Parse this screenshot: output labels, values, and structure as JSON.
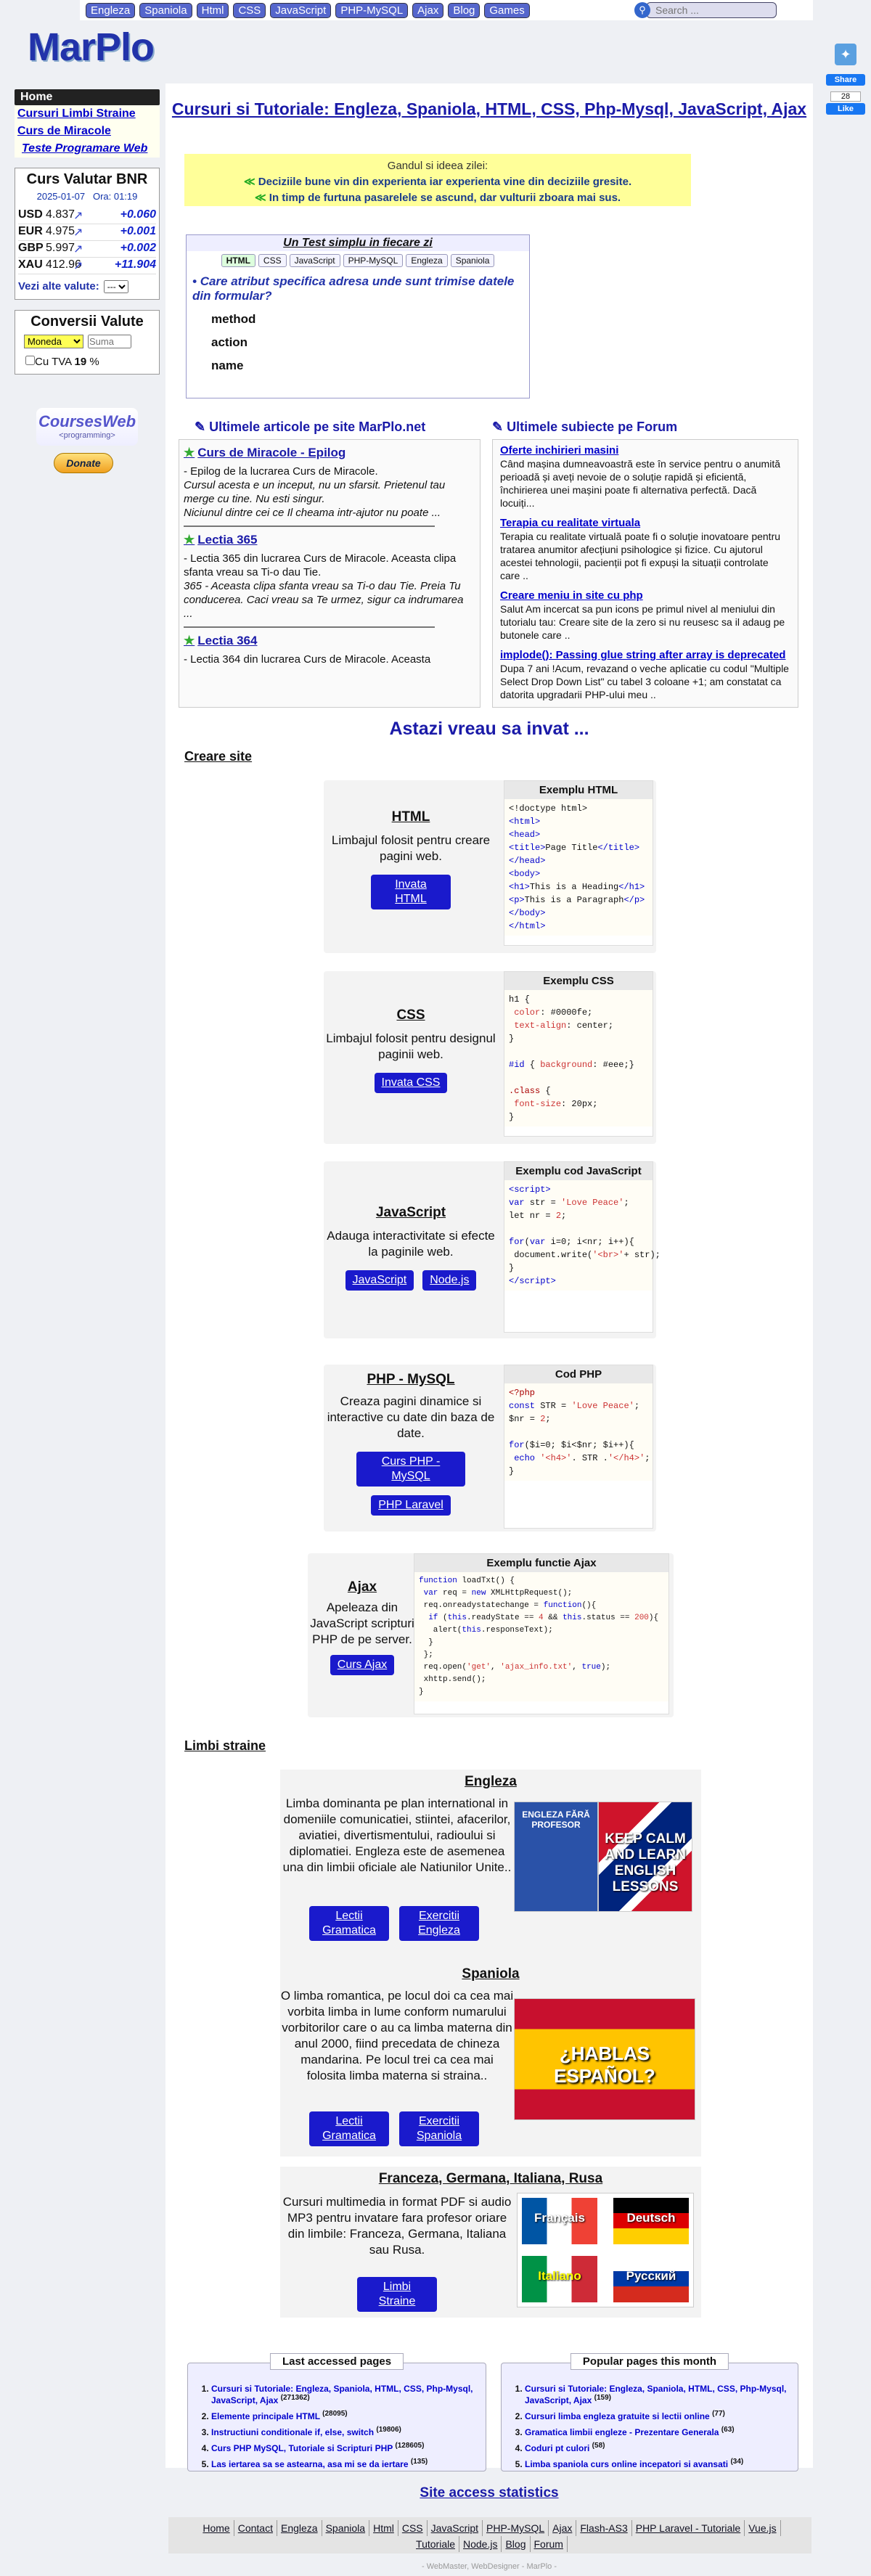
{
  "topnav": {
    "items": [
      "Engleza",
      "Spaniola",
      "Html",
      "CSS",
      "JavaScript",
      "PHP-MySQL",
      "Ajax",
      "Blog",
      "Games"
    ],
    "search_placeholder": "Search ..."
  },
  "logo": "MarPlo",
  "social": {
    "share": "Share",
    "count1": "28",
    "like": "Like"
  },
  "sidebar": {
    "home": "Home",
    "links": [
      "Cursuri Limbi Straine",
      "Curs de Miracole",
      "Teste Programare Web"
    ]
  },
  "currency": {
    "title": "Curs Valutar BNR",
    "date": "2025-01-07",
    "time": "Ora: 01:19",
    "rows": [
      {
        "code": "USD",
        "value": "4.837",
        "delta": "+0.060"
      },
      {
        "code": "EUR",
        "value": "4.975",
        "delta": "+0.001"
      },
      {
        "code": "GBP",
        "value": "5.997",
        "delta": "+0.002"
      },
      {
        "code": "XAU",
        "value": "412.96",
        "delta": "+11.904"
      }
    ],
    "vezi": "Vezi alte valute:",
    "select": "---"
  },
  "conversii": {
    "title": "Conversii Valute",
    "moneda": "Moneda",
    "suma": "Suma",
    "tva_label": "Cu TVA",
    "tva_value": "19",
    "tva_pct": "%"
  },
  "coursesweb": {
    "t1": "CoursesWeb",
    "t2": "<programming>"
  },
  "donate": "Donate",
  "page_title": "Cursuri si Tutoriale: Engleza, Spaniola, HTML, CSS, Php-Mysql, JavaScript, Ajax",
  "gandul": {
    "title": "Gandul si ideea zilei:",
    "lines": [
      "Deciziile bune vin din experienta iar experienta vine din deciziile gresite.",
      "In timp de furtuna pasarelele se ascund, dar vulturii zboara mai sus."
    ]
  },
  "test": {
    "title": "Un Test simplu in fiecare zi",
    "tags": [
      "HTML",
      "CSS",
      "JavaScript",
      "PHP-MySQL",
      "Engleza",
      "Spaniola"
    ],
    "question": "Care atribut specifica adresa unde sunt trimise datele din formular?",
    "options": [
      "method",
      "action",
      "name"
    ]
  },
  "articles": {
    "title": "Ultimele articole pe site MarPlo.net",
    "items": [
      {
        "title": "Curs de Miracole - Epilog",
        "text": "- Epilog de la lucrarea Curs de Miracole.",
        "italic": "Cursul acesta e un inceput, nu un sfarsit. Prietenul tau merge cu tine. Nu esti singur.",
        "tail": "Niciunul dintre cei ce Il cheama intr-ajutor nu poate ..."
      },
      {
        "title": "Lectia 365",
        "text": "- Lectia 365 din lucrarea Curs de Miracole. Aceasta clipa sfanta vreau sa Ti-o dau Tie.",
        "italic": "365 - Aceasta clipa sfanta vreau sa Ti-o dau Tie. Preia Tu conducerea. Caci vreau sa Te urmez, sigur ca indrumarea ..."
      },
      {
        "title": "Lectia 364",
        "text": "- Lectia 364 din lucrarea Curs de Miracole. Aceasta"
      }
    ]
  },
  "forum": {
    "title": "Ultimele subiecte pe Forum",
    "items": [
      {
        "title": "Oferte inchirieri masini",
        "text": "Când mașina dumneavoastră este în service pentru o anumită perioadă și aveți nevoie de o soluție rapidă și eficientă, închirierea unei mașini poate fi alternativa perfectă. Dacă locuiți..."
      },
      {
        "title": "Terapia cu realitate virtuala",
        "text": "Terapia cu realitate virtuală poate fi o soluție inovatoare pentru tratarea anumitor afecțiuni psihologice și fizice. Cu ajutorul acestei tehnologii, pacienții pot fi expuși la situații controlate care .."
      },
      {
        "title": "Creare meniu in site cu php",
        "text": "Salut Am incercat sa pun icons pe primul nivel al meniului din tutorialu tau: Creare site de la zero si nu reusesc sa il adaug pe butonele care .."
      },
      {
        "title": "implode(): Passing glue string after array is deprecated",
        "text": "Dupa 7 ani !Acum, revazand o veche aplicatie cu codul \"Multiple Select Drop Down List\" cu tabel 3 coloane +1; am constatat ca datorita upgradarii PHP-ului meu .."
      }
    ]
  },
  "astazi": "Astazi vreau sa invat ...",
  "creare_site": "Creare site",
  "cards": {
    "html": {
      "title": "HTML",
      "desc": "Limbajul folosit pentru creare pagini web.",
      "btn": "Invata HTML",
      "code_title": "Exemplu HTML"
    },
    "css": {
      "title": "CSS",
      "desc": "Limbajul folosit pentru designul paginii web.",
      "btn": "Invata CSS",
      "code_title": "Exemplu CSS"
    },
    "js": {
      "title": "JavaScript",
      "desc": "Adauga interactivitate si efecte la paginile web.",
      "btn": "JavaScript",
      "btn2": "Node.js",
      "code_title": "Exemplu cod JavaScript"
    },
    "php": {
      "title": "PHP - MySQL",
      "desc": "Creaza pagini dinamice si interactive cu date din baza de date.",
      "btn": "Curs PHP - MySQL",
      "btn2": "PHP Laravel",
      "code_title": "Cod PHP"
    },
    "ajax": {
      "title": "Ajax",
      "desc": "Apeleaza din JavaScript scripturi PHP de pe server.",
      "btn": "Curs Ajax",
      "code_title": "Exemplu functie Ajax"
    }
  },
  "limbi": {
    "title": "Limbi straine",
    "engleza": {
      "title": "Engleza",
      "desc": "Limba dominanta pe plan international in domeniile comunicatiei, stiintei, afacerilor, aviatiei, divertismentului, radioului si diplomatiei. Engleza este de asemenea una din limbii oficiale ale Natiunilor Unite..",
      "btn1": "Lectii Gramatica",
      "btn2": "Exercitii Engleza",
      "img1": "ENGLEZA FĂRĂ PROFESOR",
      "img2": "KEEP CALM AND LEARN ENGLISH LESSONS"
    },
    "spaniola": {
      "title": "Spaniola",
      "desc": "O limba romantica, pe locul doi ca cea mai vorbita limba in lume conform numarului vorbitorilor care o au ca limba materna din anul 2000, fiind precedata de chineza mandarina. Pe locul trei ca cea mai folosita limba materna si straina..",
      "btn1": "Lectii Gramatica",
      "btn2": "Exercitii Spaniola",
      "img": "¿HABLAS ESPAÑOL?"
    },
    "fgir": {
      "title": "Franceza, Germana, Italiana, Rusa",
      "desc": "Cursuri multimedia in format PDF si audio MP3 pentru invatare fara profesor oriare din limbile: Franceza, Germana, Italiana sau Rusa.",
      "btn": "Limbi Straine",
      "langs": [
        "Français",
        "Deutsch",
        "Italiano",
        "Русский"
      ]
    }
  },
  "last_accessed": {
    "title": "Last accessed pages",
    "items": [
      {
        "t": "Cursuri si Tutoriale: Engleza, Spaniola, HTML, CSS, Php-Mysql, JavaScript, Ajax",
        "n": "(271362)"
      },
      {
        "t": "Elemente principale HTML",
        "n": "(28095)"
      },
      {
        "t": "Instructiuni conditionale if, else, switch",
        "n": "(19806)"
      },
      {
        "t": "Curs PHP MySQL, Tutoriale si Scripturi PHP",
        "n": "(128605)"
      },
      {
        "t": "Las iertarea sa se astearna, asa mi se da iertare",
        "n": "(135)"
      }
    ]
  },
  "popular": {
    "title": "Popular pages this month",
    "items": [
      {
        "t": "Cursuri si Tutoriale: Engleza, Spaniola, HTML, CSS, Php-Mysql, JavaScript, Ajax",
        "n": "(159)"
      },
      {
        "t": "Cursuri limba engleza gratuite si lectii online",
        "n": "(77)"
      },
      {
        "t": "Gramatica limbii engleze - Prezentare Generala",
        "n": "(63)"
      },
      {
        "t": "Coduri pt culori",
        "n": "(58)"
      },
      {
        "t": "Limba spaniola curs online incepatori si avansati",
        "n": "(34)"
      }
    ]
  },
  "site_stats": "Site access statistics",
  "footer": [
    "Home",
    "Contact",
    "Engleza",
    "Spaniola",
    "Html",
    "CSS",
    "JavaScript",
    "PHP-MySQL",
    "Ajax",
    "Flash-AS3",
    "PHP Laravel - Tutoriale",
    "Vue.js",
    "Tutoriale",
    "Node.js",
    "Blog",
    "Forum"
  ],
  "copyright": "- WebMaster, WebDesigner - MarPlo -"
}
